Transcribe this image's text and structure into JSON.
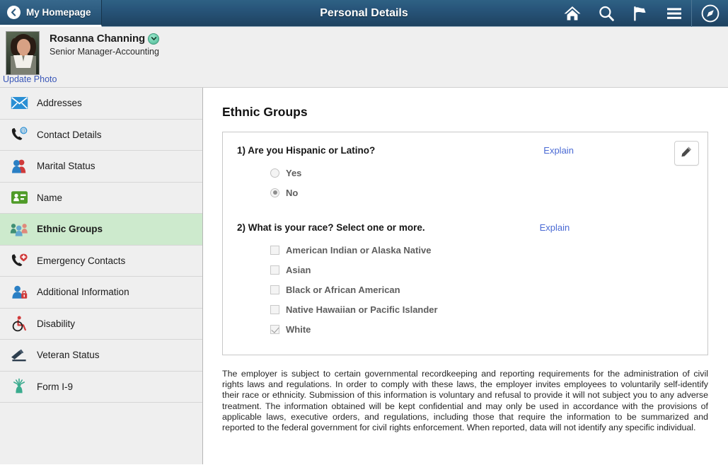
{
  "header": {
    "back_tab_label": "My Homepage",
    "back_icon": "chevron-left-icon",
    "title": "Personal Details",
    "icons": [
      {
        "name": "home-icon",
        "label": "Home"
      },
      {
        "name": "search-icon",
        "label": "Search"
      },
      {
        "name": "flag-icon",
        "label": "Notifications"
      },
      {
        "name": "hamburger-menu-icon",
        "label": "Actions Menu"
      },
      {
        "name": "compass-nav-icon",
        "label": "NavBar"
      }
    ],
    "colors": {
      "gradient_top": "#2e6184",
      "gradient_bottom": "#1e4260"
    }
  },
  "profile": {
    "name": "Rosanna Channing",
    "job_title": "Senior Manager-Accounting",
    "update_photo_label": "Update Photo",
    "badge_icon": "chevron-down-badge-icon",
    "avatar_alt": "Employee photo",
    "link_color": "#3a57b8"
  },
  "sidebar": {
    "selected_color": "#cdeacd",
    "items": [
      {
        "label": "Addresses",
        "icon": "envelope-icon",
        "selected": false
      },
      {
        "label": "Contact Details",
        "icon": "phone-at-icon",
        "selected": false
      },
      {
        "label": "Marital Status",
        "icon": "two-people-icon",
        "selected": false
      },
      {
        "label": "Name",
        "icon": "id-card-icon",
        "selected": false
      },
      {
        "label": "Ethnic Groups",
        "icon": "group-people-icon",
        "selected": true
      },
      {
        "label": "Emergency Contacts",
        "icon": "phone-medical-icon",
        "selected": false
      },
      {
        "label": "Additional Information",
        "icon": "person-lock-icon",
        "selected": false
      },
      {
        "label": "Disability",
        "icon": "wheelchair-icon",
        "selected": false
      },
      {
        "label": "Veteran Status",
        "icon": "military-rank-icon",
        "selected": false
      },
      {
        "label": "Form I-9",
        "icon": "statue-of-liberty-icon",
        "selected": false
      }
    ]
  },
  "main": {
    "page_title": "Ethnic Groups",
    "edit_button_icon": "pencil-icon",
    "explain_label": "Explain",
    "question1": {
      "text": "1) Are you Hispanic or Latino?",
      "type": "radio",
      "options": [
        {
          "label": "Yes",
          "checked": false
        },
        {
          "label": "No",
          "checked": true
        }
      ]
    },
    "question2": {
      "text": "2) What is your race? Select one or more.",
      "type": "checkbox",
      "options": [
        {
          "label": "American Indian or Alaska Native",
          "checked": false
        },
        {
          "label": "Asian",
          "checked": false
        },
        {
          "label": "Black or African American",
          "checked": false
        },
        {
          "label": "Native Hawaiian or Pacific Islander",
          "checked": false
        },
        {
          "label": "White",
          "checked": true
        }
      ]
    },
    "disclaimer": "The employer is subject to certain governmental recordkeeping and reporting requirements for the administration of civil rights laws and regulations. In order to comply with these laws, the employer invites employees to voluntarily self-identify their race or ethnicity. Submission of this information is voluntary and refusal to provide it will not subject you to any adverse treatment. The information obtained will be kept confidential and may only be used in accordance with the provisions of applicable laws, executive orders, and regulations, including those that require the information to be summarized and reported to the federal government for civil rights enforcement. When reported, data will not identify any specific individual."
  }
}
